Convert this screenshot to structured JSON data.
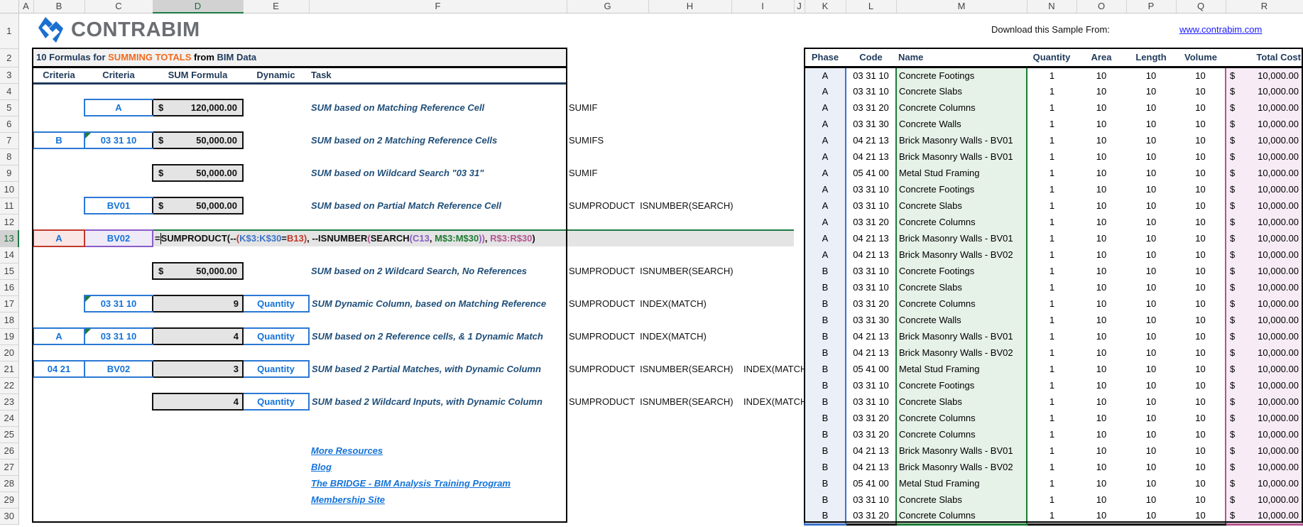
{
  "grid": {
    "columns": [
      "A",
      "B",
      "C",
      "D",
      "E",
      "F",
      "G",
      "H",
      "I",
      "J",
      "K",
      "L",
      "M",
      "N",
      "O",
      "P",
      "Q",
      "R"
    ],
    "rows": [
      "1",
      "2",
      "3",
      "4",
      "5",
      "6",
      "7",
      "8",
      "9",
      "10",
      "11",
      "12",
      "13",
      "14",
      "15",
      "16",
      "17",
      "18",
      "19",
      "20",
      "21",
      "22",
      "23",
      "24",
      "25",
      "26",
      "27",
      "28",
      "29",
      "30"
    ],
    "selected_cell": "D13"
  },
  "logo": {
    "text": "CONTRABIM"
  },
  "download": {
    "label": "Download this Sample From:",
    "link": "www.contrabim.com"
  },
  "left": {
    "title": {
      "part1": "10 Formulas for ",
      "highlight": "SUMMING TOTALS",
      "part2": " from ",
      "part3": "BIM Data"
    },
    "headers": {
      "criteria1": "Criteria",
      "criteria2": "Criteria",
      "sum_formula": "SUM Formula",
      "dynamic": "Dynamic",
      "task": "Task"
    },
    "rows": [
      {
        "crit1": "",
        "crit2": "A",
        "symbol": "$",
        "result": "120,000.00",
        "dynamic": "",
        "task": "SUM based on Matching Reference Cell",
        "functions": "SUMIF"
      },
      {
        "crit1": "B",
        "crit2": "03 31 10",
        "symbol": "$",
        "result": "50,000.00",
        "dynamic": "",
        "task": "SUM based on 2 Matching Reference Cells",
        "functions": "SUMIFS"
      },
      {
        "crit1": "",
        "crit2": "",
        "symbol": "$",
        "result": "50,000.00",
        "dynamic": "",
        "task": "SUM based on Wildcard Search \"03 31\"",
        "functions": "SUMIF"
      },
      {
        "crit1": "",
        "crit2": "BV01",
        "symbol": "$",
        "result": "50,000.00",
        "dynamic": "",
        "task": "SUM based on Partial Match Reference Cell",
        "functions": "SUMPRODUCT  ISNUMBER(SEARCH)"
      },
      {
        "crit1": "",
        "crit2": "",
        "symbol": "$",
        "result": "50,000.00",
        "dynamic": "",
        "task": "SUM based on 2 Wildcard Search, No References",
        "functions": "SUMPRODUCT  ISNUMBER(SEARCH)"
      },
      {
        "crit1": "",
        "crit2": "03 31 10",
        "symbol": "",
        "result": "9",
        "dynamic": "Quantity",
        "task": "SUM Dynamic Column, based on Matching Reference",
        "functions": "SUMPRODUCT  INDEX(MATCH)"
      },
      {
        "crit1": "A",
        "crit2": "03 31 10",
        "symbol": "",
        "result": "4",
        "dynamic": "Quantity",
        "task": "SUM based on 2 Reference cells, & 1 Dynamic Match",
        "functions": "SUMPRODUCT  INDEX(MATCH)"
      },
      {
        "crit1": "04 21",
        "crit2": "BV02",
        "symbol": "",
        "result": "3",
        "dynamic": "Quantity",
        "task": "SUM based 2 Partial Matches, with Dynamic Column",
        "functions": "SUMPRODUCT  ISNUMBER(SEARCH)    INDEX(MATCH)"
      },
      {
        "crit1": "",
        "crit2": "",
        "symbol": "",
        "result": "4",
        "dynamic": "Quantity",
        "task": "SUM based 2 Wildcard Inputs, with Dynamic Column",
        "functions": "SUMPRODUCT  ISNUMBER(SEARCH)    INDEX(MATCH)"
      }
    ],
    "edit_row": {
      "crit1": "A",
      "crit2": "BV02",
      "formula_tokens": [
        {
          "t": "=",
          "c": "#111111"
        },
        {
          "t": "SUMPRODUCT(",
          "c": "#111111"
        },
        {
          "t": "--",
          "c": "#111111"
        },
        {
          "t": "(",
          "c": "#c0392b"
        },
        {
          "t": "K$3:K$30",
          "c": "#3c74c8"
        },
        {
          "t": "=",
          "c": "#111111"
        },
        {
          "t": "B13",
          "c": "#c0392b"
        },
        {
          "t": ")",
          "c": "#c0392b"
        },
        {
          "t": ", --ISNUMBER",
          "c": "#111111"
        },
        {
          "t": "(",
          "c": "#b4558f"
        },
        {
          "t": "SEARCH",
          "c": "#111111"
        },
        {
          "t": "(",
          "c": "#8a5cc7"
        },
        {
          "t": "C13",
          "c": "#8a5cc7"
        },
        {
          "t": ", ",
          "c": "#111111"
        },
        {
          "t": "M$3:M$30",
          "c": "#1e7b34"
        },
        {
          "t": ")",
          "c": "#8a5cc7"
        },
        {
          "t": ")",
          "c": "#b4558f"
        },
        {
          "t": ", ",
          "c": "#111111"
        },
        {
          "t": "R$3:R$30",
          "c": "#b4558f"
        },
        {
          "t": ")",
          "c": "#111111"
        }
      ]
    },
    "links": [
      "More Resources",
      "Blog",
      "The BRIDGE - BIM Analysis Training Program",
      "Membership Site"
    ]
  },
  "right": {
    "headers": {
      "phase": "Phase",
      "code": "Code",
      "name": "Name",
      "quantity": "Quantity",
      "area": "Area",
      "length": "Length",
      "volume": "Volume",
      "total_cost": "Total Cost"
    },
    "rows": [
      {
        "phase": "A",
        "code": "03 31 10",
        "name": "Concrete Footings",
        "quantity": "1",
        "area": "10",
        "length": "10",
        "volume": "10",
        "cur": "$",
        "cost": "10,000.00"
      },
      {
        "phase": "A",
        "code": "03 31 10",
        "name": "Concrete Slabs",
        "quantity": "1",
        "area": "10",
        "length": "10",
        "volume": "10",
        "cur": "$",
        "cost": "10,000.00"
      },
      {
        "phase": "A",
        "code": "03 31 20",
        "name": "Concrete Columns",
        "quantity": "1",
        "area": "10",
        "length": "10",
        "volume": "10",
        "cur": "$",
        "cost": "10,000.00"
      },
      {
        "phase": "A",
        "code": "03 31 30",
        "name": "Concrete Walls",
        "quantity": "1",
        "area": "10",
        "length": "10",
        "volume": "10",
        "cur": "$",
        "cost": "10,000.00"
      },
      {
        "phase": "A",
        "code": "04 21 13",
        "name": "Brick Masonry Walls - BV01",
        "quantity": "1",
        "area": "10",
        "length": "10",
        "volume": "10",
        "cur": "$",
        "cost": "10,000.00"
      },
      {
        "phase": "A",
        "code": "04 21 13",
        "name": "Brick Masonry Walls - BV01",
        "quantity": "1",
        "area": "10",
        "length": "10",
        "volume": "10",
        "cur": "$",
        "cost": "10,000.00"
      },
      {
        "phase": "A",
        "code": "05 41 00",
        "name": "Metal Stud Framing",
        "quantity": "1",
        "area": "10",
        "length": "10",
        "volume": "10",
        "cur": "$",
        "cost": "10,000.00"
      },
      {
        "phase": "A",
        "code": "03 31 10",
        "name": "Concrete Footings",
        "quantity": "1",
        "area": "10",
        "length": "10",
        "volume": "10",
        "cur": "$",
        "cost": "10,000.00"
      },
      {
        "phase": "A",
        "code": "03 31 10",
        "name": "Concrete Slabs",
        "quantity": "1",
        "area": "10",
        "length": "10",
        "volume": "10",
        "cur": "$",
        "cost": "10,000.00"
      },
      {
        "phase": "A",
        "code": "03 31 20",
        "name": "Concrete Columns",
        "quantity": "1",
        "area": "10",
        "length": "10",
        "volume": "10",
        "cur": "$",
        "cost": "10,000.00"
      },
      {
        "phase": "A",
        "code": "04 21 13",
        "name": "Brick Masonry Walls - BV01",
        "quantity": "1",
        "area": "10",
        "length": "10",
        "volume": "10",
        "cur": "$",
        "cost": "10,000.00"
      },
      {
        "phase": "A",
        "code": "04 21 13",
        "name": "Brick Masonry Walls - BV02",
        "quantity": "1",
        "area": "10",
        "length": "10",
        "volume": "10",
        "cur": "$",
        "cost": "10,000.00"
      },
      {
        "phase": "B",
        "code": "03 31 10",
        "name": "Concrete Footings",
        "quantity": "1",
        "area": "10",
        "length": "10",
        "volume": "10",
        "cur": "$",
        "cost": "10,000.00"
      },
      {
        "phase": "B",
        "code": "03 31 10",
        "name": "Concrete Slabs",
        "quantity": "1",
        "area": "10",
        "length": "10",
        "volume": "10",
        "cur": "$",
        "cost": "10,000.00"
      },
      {
        "phase": "B",
        "code": "03 31 20",
        "name": "Concrete Columns",
        "quantity": "1",
        "area": "10",
        "length": "10",
        "volume": "10",
        "cur": "$",
        "cost": "10,000.00"
      },
      {
        "phase": "B",
        "code": "03 31 30",
        "name": "Concrete Walls",
        "quantity": "1",
        "area": "10",
        "length": "10",
        "volume": "10",
        "cur": "$",
        "cost": "10,000.00"
      },
      {
        "phase": "B",
        "code": "04 21 13",
        "name": "Brick Masonry Walls - BV01",
        "quantity": "1",
        "area": "10",
        "length": "10",
        "volume": "10",
        "cur": "$",
        "cost": "10,000.00"
      },
      {
        "phase": "B",
        "code": "04 21 13",
        "name": "Brick Masonry Walls - BV02",
        "quantity": "1",
        "area": "10",
        "length": "10",
        "volume": "10",
        "cur": "$",
        "cost": "10,000.00"
      },
      {
        "phase": "B",
        "code": "05 41 00",
        "name": "Metal Stud Framing",
        "quantity": "1",
        "area": "10",
        "length": "10",
        "volume": "10",
        "cur": "$",
        "cost": "10,000.00"
      },
      {
        "phase": "B",
        "code": "03 31 10",
        "name": "Concrete Footings",
        "quantity": "1",
        "area": "10",
        "length": "10",
        "volume": "10",
        "cur": "$",
        "cost": "10,000.00"
      },
      {
        "phase": "B",
        "code": "03 31 10",
        "name": "Concrete Slabs",
        "quantity": "1",
        "area": "10",
        "length": "10",
        "volume": "10",
        "cur": "$",
        "cost": "10,000.00"
      },
      {
        "phase": "B",
        "code": "03 31 20",
        "name": "Concrete Columns",
        "quantity": "1",
        "area": "10",
        "length": "10",
        "volume": "10",
        "cur": "$",
        "cost": "10,000.00"
      },
      {
        "phase": "B",
        "code": "03 31 20",
        "name": "Concrete Columns",
        "quantity": "1",
        "area": "10",
        "length": "10",
        "volume": "10",
        "cur": "$",
        "cost": "10,000.00"
      },
      {
        "phase": "B",
        "code": "04 21 13",
        "name": "Brick Masonry Walls - BV01",
        "quantity": "1",
        "area": "10",
        "length": "10",
        "volume": "10",
        "cur": "$",
        "cost": "10,000.00"
      },
      {
        "phase": "B",
        "code": "04 21 13",
        "name": "Brick Masonry Walls - BV02",
        "quantity": "1",
        "area": "10",
        "length": "10",
        "volume": "10",
        "cur": "$",
        "cost": "10,000.00"
      },
      {
        "phase": "B",
        "code": "05 41 00",
        "name": "Metal Stud Framing",
        "quantity": "1",
        "area": "10",
        "length": "10",
        "volume": "10",
        "cur": "$",
        "cost": "10,000.00"
      },
      {
        "phase": "B",
        "code": "03 31 10",
        "name": "Concrete Slabs",
        "quantity": "1",
        "area": "10",
        "length": "10",
        "volume": "10",
        "cur": "$",
        "cost": "10,000.00"
      },
      {
        "phase": "B",
        "code": "03 31 20",
        "name": "Concrete Columns",
        "quantity": "1",
        "area": "10",
        "length": "10",
        "volume": "10",
        "cur": "$",
        "cost": "10,000.00"
      }
    ]
  }
}
